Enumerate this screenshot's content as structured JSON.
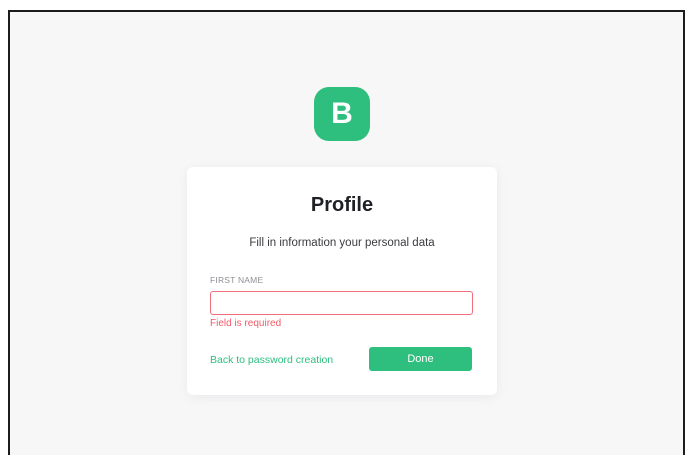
{
  "app": {
    "logo_letter": "B",
    "brand_color": "#2ebf7f",
    "error_color": "#ef5b69"
  },
  "card": {
    "title": "Profile",
    "subtitle": "Fill in information your personal data",
    "first_name": {
      "label": "FIRST NAME",
      "value": "",
      "placeholder": "",
      "error": "Field is required"
    },
    "back_link": "Back to password creation",
    "done_label": "Done"
  }
}
